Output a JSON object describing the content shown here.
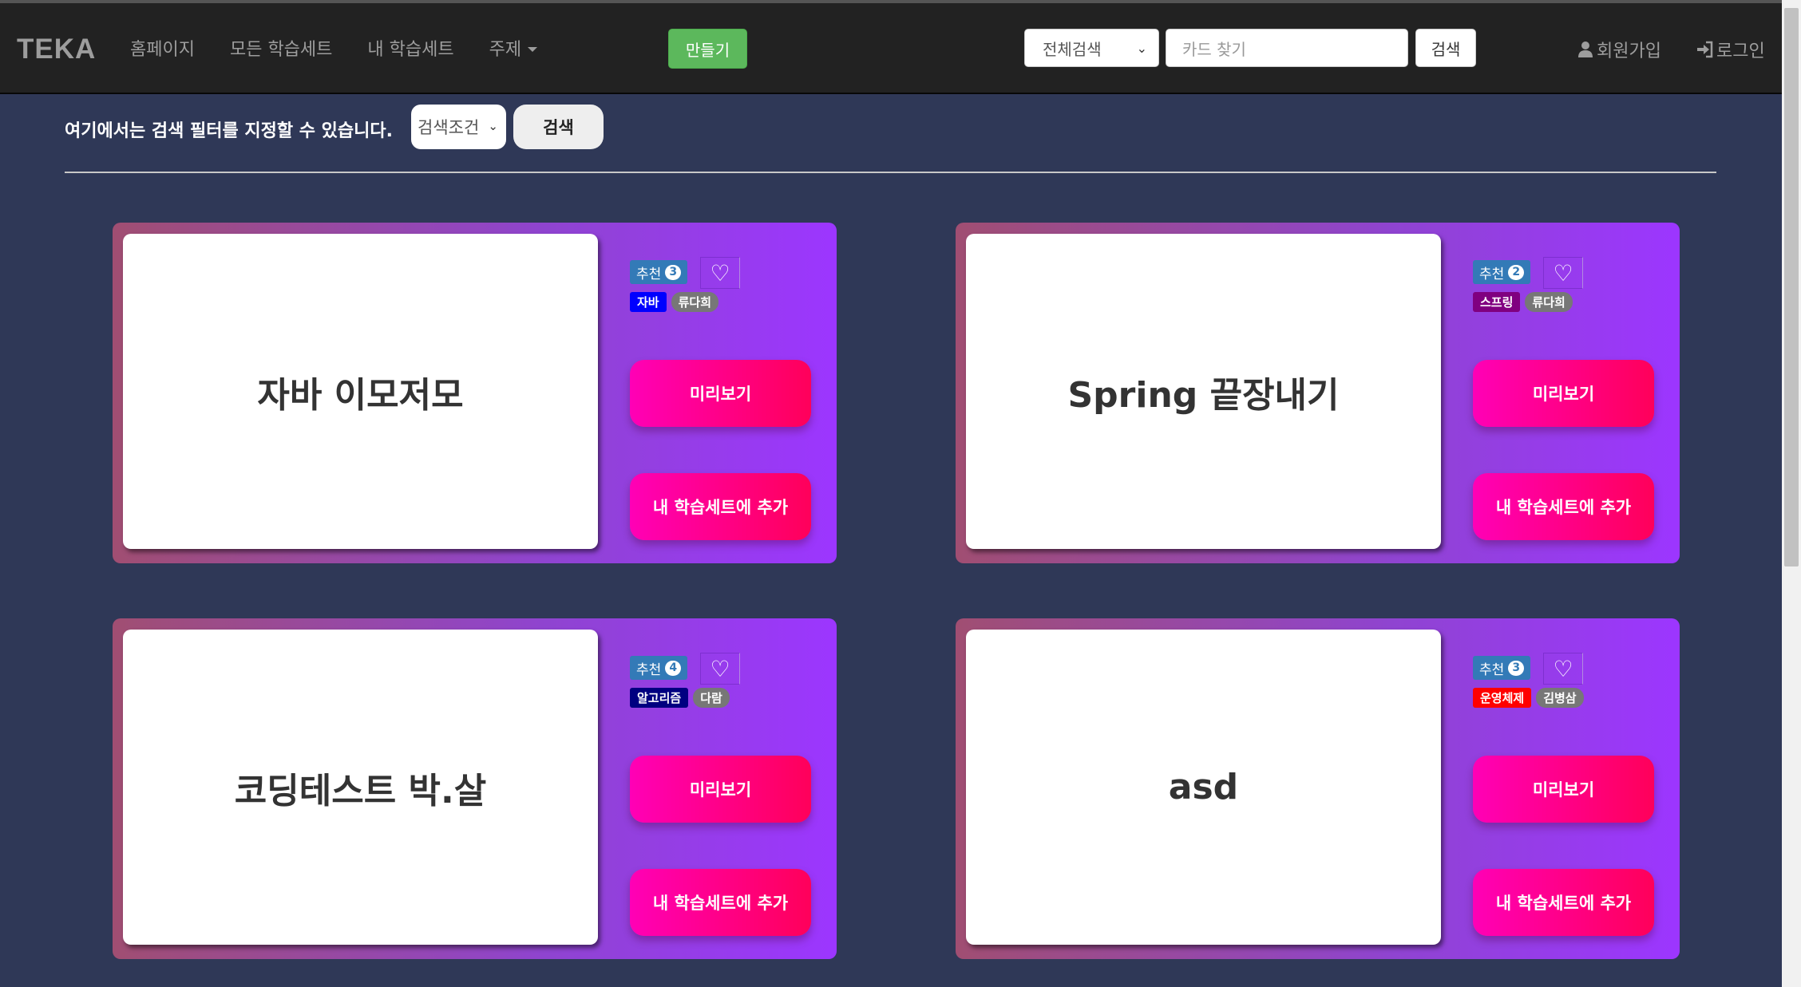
{
  "navbar": {
    "brand": "TEKA",
    "links": [
      "홈페이지",
      "모든 학습세트",
      "내 학습세트",
      "주제"
    ],
    "make_label": "만들기",
    "search_scope": "전체검색",
    "search_placeholder": "카드 찾기",
    "search_button": "검색",
    "signup_label": "회원가입",
    "login_label": "로그인"
  },
  "filter": {
    "text": "여기에서는 검색 필터를 지정할 수 있습니다.",
    "select_value": "검색조건",
    "button": "검색"
  },
  "cards": [
    {
      "title": "자바 이모저모",
      "rec_label": "추천",
      "rec_count": "3",
      "category": "자바",
      "category_color": "#0000ff",
      "author": "류다희",
      "preview_label": "미리보기",
      "add_label": "내 학습세트에 추가"
    },
    {
      "title": "Spring 끝장내기",
      "rec_label": "추천",
      "rec_count": "2",
      "category": "스프링",
      "category_color": "#800080",
      "author": "류다희",
      "preview_label": "미리보기",
      "add_label": "내 학습세트에 추가"
    },
    {
      "title": "코딩테스트 박.살",
      "rec_label": "추천",
      "rec_count": "4",
      "category": "알고리즘",
      "category_color": "#000080",
      "author": "다람",
      "preview_label": "미리보기",
      "add_label": "내 학습세트에 추가"
    },
    {
      "title": "asd",
      "rec_label": "추천",
      "rec_count": "3",
      "category": "운영체제",
      "category_color": "#ff0000",
      "author": "김병삼",
      "preview_label": "미리보기",
      "add_label": "내 학습세트에 추가"
    }
  ],
  "colors": {
    "background": "#2f3857",
    "navbar": "#222222",
    "make_button": "#5cb85c",
    "pink_gradient_start": "#ff00b6",
    "pink_gradient_end": "#ff005a"
  }
}
